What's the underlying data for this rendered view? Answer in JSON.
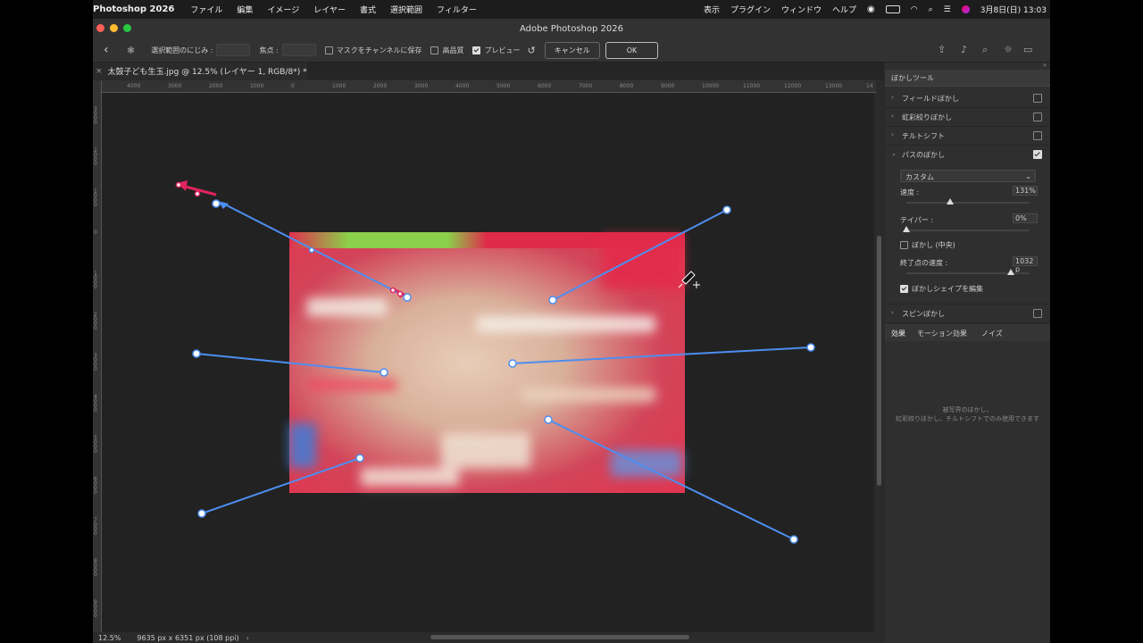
{
  "menubar": {
    "app_name": "Photoshop 2026",
    "items": [
      "ファイル",
      "編集",
      "イメージ",
      "レイヤー",
      "書式",
      "選択範囲",
      "フィルター"
    ],
    "right_items": [
      "表示",
      "プラグイン",
      "ウィンドウ",
      "ヘルプ"
    ],
    "datetime": "3月8日(日)  13:03"
  },
  "window": {
    "title": "Adobe Photoshop 2026"
  },
  "options_bar": {
    "feather_label": "選択範囲のにじみ :",
    "focus_label": "焦点 :",
    "save_mask_label": "マスクをチャンネルに保存",
    "high_quality_label": "高品質",
    "preview_label": "プレビュー",
    "cancel_label": "キャンセル",
    "ok_label": "OK"
  },
  "document": {
    "tab_title": "太鼓子ども生玉.jpg @ 12.5% (レイヤー 1, RGB/8*) *"
  },
  "ruler": {
    "h_labels": [
      "4000",
      "3000",
      "2000",
      "1000",
      "0",
      "1000",
      "2000",
      "3000",
      "4000",
      "5000",
      "6000",
      "7000",
      "8000",
      "9000",
      "10000",
      "11000",
      "12000",
      "13000",
      "14"
    ],
    "v_labels": [
      "3\n0\n0\n0",
      "2\n0\n0\n0",
      "1\n0\n0\n0",
      "0",
      "1\n0\n0\n0",
      "2\n0\n0\n0",
      "3\n0\n0\n0",
      "4\n0\n0\n0",
      "5\n0\n0\n0",
      "6\n0\n0\n0",
      "7\n0\n0\n0",
      "8\n0\n0\n0",
      "9\n0\n0\n0"
    ]
  },
  "status": {
    "zoom": "12.5%",
    "doc_info": "9635 px x 6351 px (108 ppi)"
  },
  "panel": {
    "title": "ぼかしツール",
    "items": [
      {
        "label": "フィールドぼかし",
        "checked": false
      },
      {
        "label": "虹彩絞りぼかし",
        "checked": false
      },
      {
        "label": "チルトシフト",
        "checked": false
      },
      {
        "label": "パスのぼかし",
        "checked": true
      }
    ],
    "preset": "カスタム",
    "speed_label": "速度 :",
    "speed_value": "131%",
    "speed_level": 0.38,
    "taper_label": "テイパー :",
    "taper_value": "0%",
    "taper_level": 0.0,
    "center_blur_label": "ぼかし (中央)",
    "end_speed_label": "終了点の速度 :",
    "end_speed_value": "1032 p",
    "end_speed_level": 0.9,
    "edit_shapes_label": "ぼかしシェイプを編集",
    "spin_label": "スピンぼかし",
    "tabs": [
      "効果",
      "モーション効果",
      "ノイズ"
    ],
    "empty_line1": "被写界のぼかし、",
    "empty_line2": "虹彩絞りぼかし、チルトシフトでのみ使用できます"
  },
  "colors": {
    "accent_blue": "#4d8ef0",
    "arrow_red": "#e0245e"
  }
}
